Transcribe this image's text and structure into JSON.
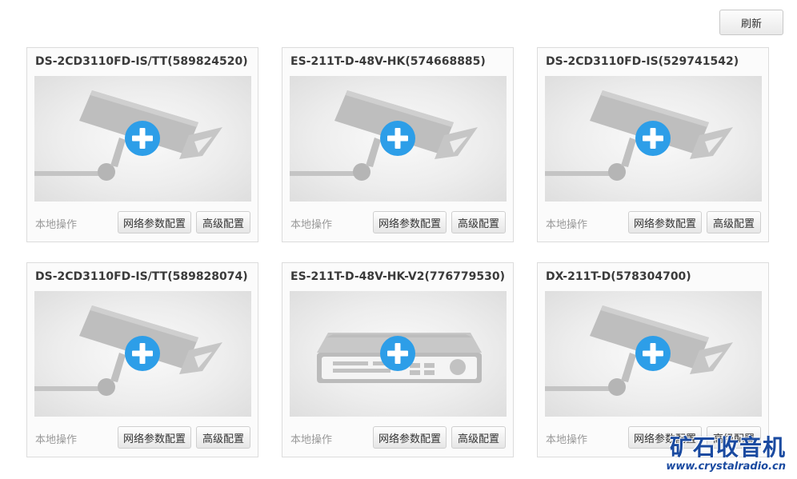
{
  "toolbar": {
    "refresh_label": "刷新"
  },
  "cards": [
    {
      "title": "DS-2CD3110FD-IS/TT(589824520)",
      "device_icon": "camera-icon",
      "local_label": "本地操作",
      "net_config_label": "网络参数配置",
      "adv_config_label": "高级配置"
    },
    {
      "title": "ES-211T-D-48V-HK(574668885)",
      "device_icon": "camera-icon",
      "local_label": "本地操作",
      "net_config_label": "网络参数配置",
      "adv_config_label": "高级配置"
    },
    {
      "title": "DS-2CD3110FD-IS(529741542)",
      "device_icon": "camera-icon",
      "local_label": "本地操作",
      "net_config_label": "网络参数配置",
      "adv_config_label": "高级配置"
    },
    {
      "title": "DS-2CD3110FD-IS/TT(589828074)",
      "device_icon": "camera-icon",
      "local_label": "本地操作",
      "net_config_label": "网络参数配置",
      "adv_config_label": "高级配置"
    },
    {
      "title": "ES-211T-D-48V-HK-V2(776779530)",
      "device_icon": "nvr-icon",
      "local_label": "本地操作",
      "net_config_label": "网络参数配置",
      "adv_config_label": "高级配置"
    },
    {
      "title": "DX-211T-D(578304700)",
      "device_icon": "camera-icon",
      "local_label": "本地操作",
      "net_config_label": "网络参数配置",
      "adv_config_label": "高级配置"
    }
  ],
  "watermark": {
    "title": "矿石收音机",
    "url": "www.crystalradio.cn"
  },
  "colors": {
    "accent": "#2d9ee8",
    "device_gray": "#bdbdbd"
  }
}
